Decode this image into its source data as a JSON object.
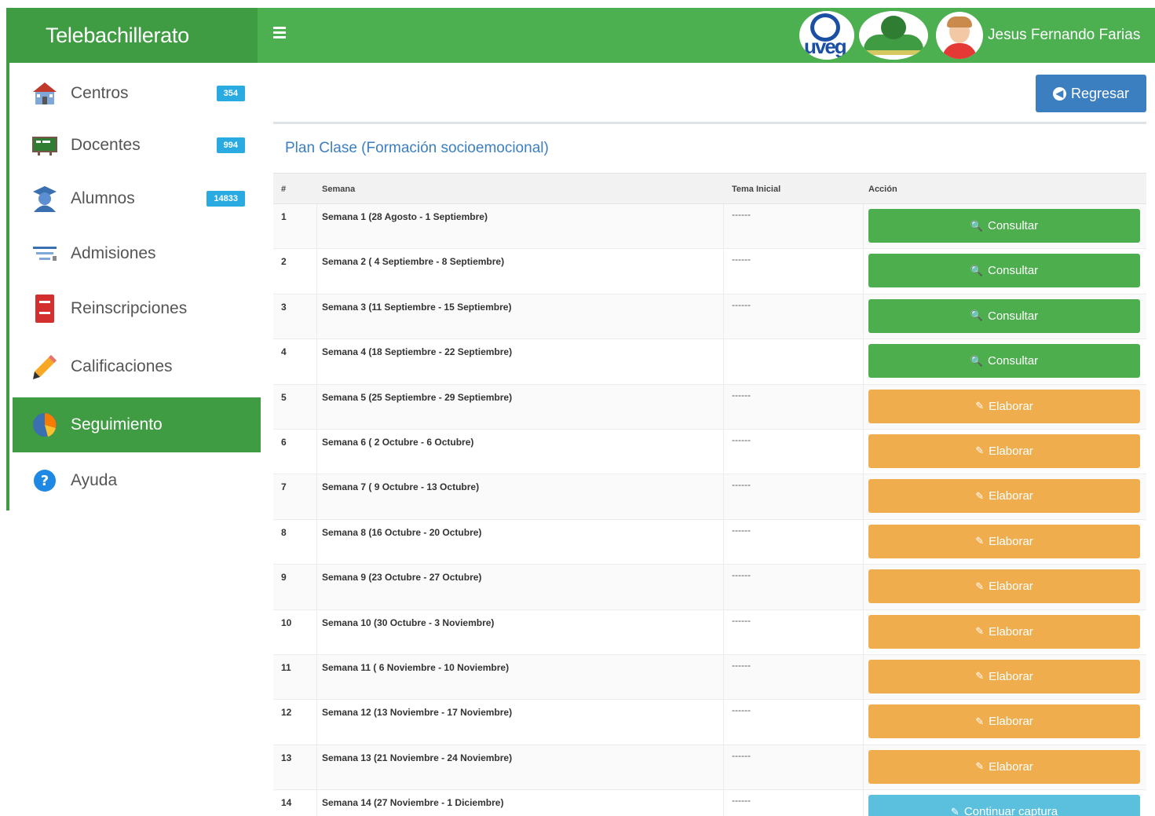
{
  "header": {
    "brand": "Telebachillerato",
    "menu_icon": "hamburger-icon",
    "logos": {
      "uveg_text": "uveg"
    },
    "user_name": "Jesus Fernando Farias"
  },
  "sidebar": {
    "items": [
      {
        "label": "Centros",
        "badge": "354",
        "icon": "school-icon"
      },
      {
        "label": "Docentes",
        "badge": "994",
        "icon": "chalkboard-icon"
      },
      {
        "label": "Alumnos",
        "badge": "14833",
        "icon": "student-icon"
      },
      {
        "label": "Admisiones",
        "badge": "",
        "icon": "filter-list-icon"
      },
      {
        "label": "Reinscripciones",
        "badge": "",
        "icon": "notebook-icon"
      },
      {
        "label": "Calificaciones",
        "badge": "",
        "icon": "pencil-icon"
      },
      {
        "label": "Seguimiento",
        "badge": "",
        "icon": "pie-chart-icon",
        "active": true
      },
      {
        "label": "Ayuda",
        "badge": "",
        "icon": "help-icon"
      }
    ]
  },
  "toolbar": {
    "back_label": "Regresar"
  },
  "panel": {
    "title": "Plan Clase (Formación socioemocional)",
    "columns": [
      "#",
      "Semana",
      "Tema Inicial",
      "Acción"
    ],
    "rows": [
      {
        "num": "1",
        "semana": "Semana 1 (28 Agosto - 1 Septiembre)",
        "tema": "------",
        "action": "Consultar",
        "style": "green"
      },
      {
        "num": "2",
        "semana": "Semana 2 ( 4 Septiembre - 8 Septiembre)",
        "tema": "------",
        "action": "Consultar",
        "style": "green"
      },
      {
        "num": "3",
        "semana": "Semana 3 (11 Septiembre - 15 Septiembre)",
        "tema": "------",
        "action": "Consultar",
        "style": "green"
      },
      {
        "num": "4",
        "semana": "Semana 4 (18 Septiembre - 22 Septiembre)",
        "tema": "",
        "action": "Consultar",
        "style": "green"
      },
      {
        "num": "5",
        "semana": "Semana 5 (25 Septiembre - 29 Septiembre)",
        "tema": "------",
        "action": "Elaborar",
        "style": "orange"
      },
      {
        "num": "6",
        "semana": "Semana 6 ( 2 Octubre - 6 Octubre)",
        "tema": "------",
        "action": "Elaborar",
        "style": "orange"
      },
      {
        "num": "7",
        "semana": "Semana 7 ( 9 Octubre - 13 Octubre)",
        "tema": "------",
        "action": "Elaborar",
        "style": "orange"
      },
      {
        "num": "8",
        "semana": "Semana 8 (16 Octubre - 20 Octubre)",
        "tema": "------",
        "action": "Elaborar",
        "style": "orange"
      },
      {
        "num": "9",
        "semana": "Semana 9 (23 Octubre - 27 Octubre)",
        "tema": "------",
        "action": "Elaborar",
        "style": "orange"
      },
      {
        "num": "10",
        "semana": "Semana 10 (30 Octubre - 3 Noviembre)",
        "tema": "------",
        "action": "Elaborar",
        "style": "orange"
      },
      {
        "num": "11",
        "semana": "Semana 11 ( 6 Noviembre - 10 Noviembre)",
        "tema": "------",
        "action": "Elaborar",
        "style": "orange"
      },
      {
        "num": "12",
        "semana": "Semana 12 (13 Noviembre - 17 Noviembre)",
        "tema": "------",
        "action": "Elaborar",
        "style": "orange"
      },
      {
        "num": "13",
        "semana": "Semana 13 (21 Noviembre - 24 Noviembre)",
        "tema": "------",
        "action": "Elaborar",
        "style": "orange"
      },
      {
        "num": "14",
        "semana": "Semana 14 (27 Noviembre - 1 Diciembre)",
        "tema": "------",
        "action": "Continuar captura",
        "style": "blue"
      }
    ]
  },
  "colors": {
    "primary_green": "#4caf50",
    "dark_green": "#3f9c43",
    "badge_blue": "#29abe2",
    "button_blue": "#3c7fc1",
    "btn_green": "#4cae4c",
    "btn_orange": "#f0ad4e",
    "btn_info": "#5bc0de"
  }
}
